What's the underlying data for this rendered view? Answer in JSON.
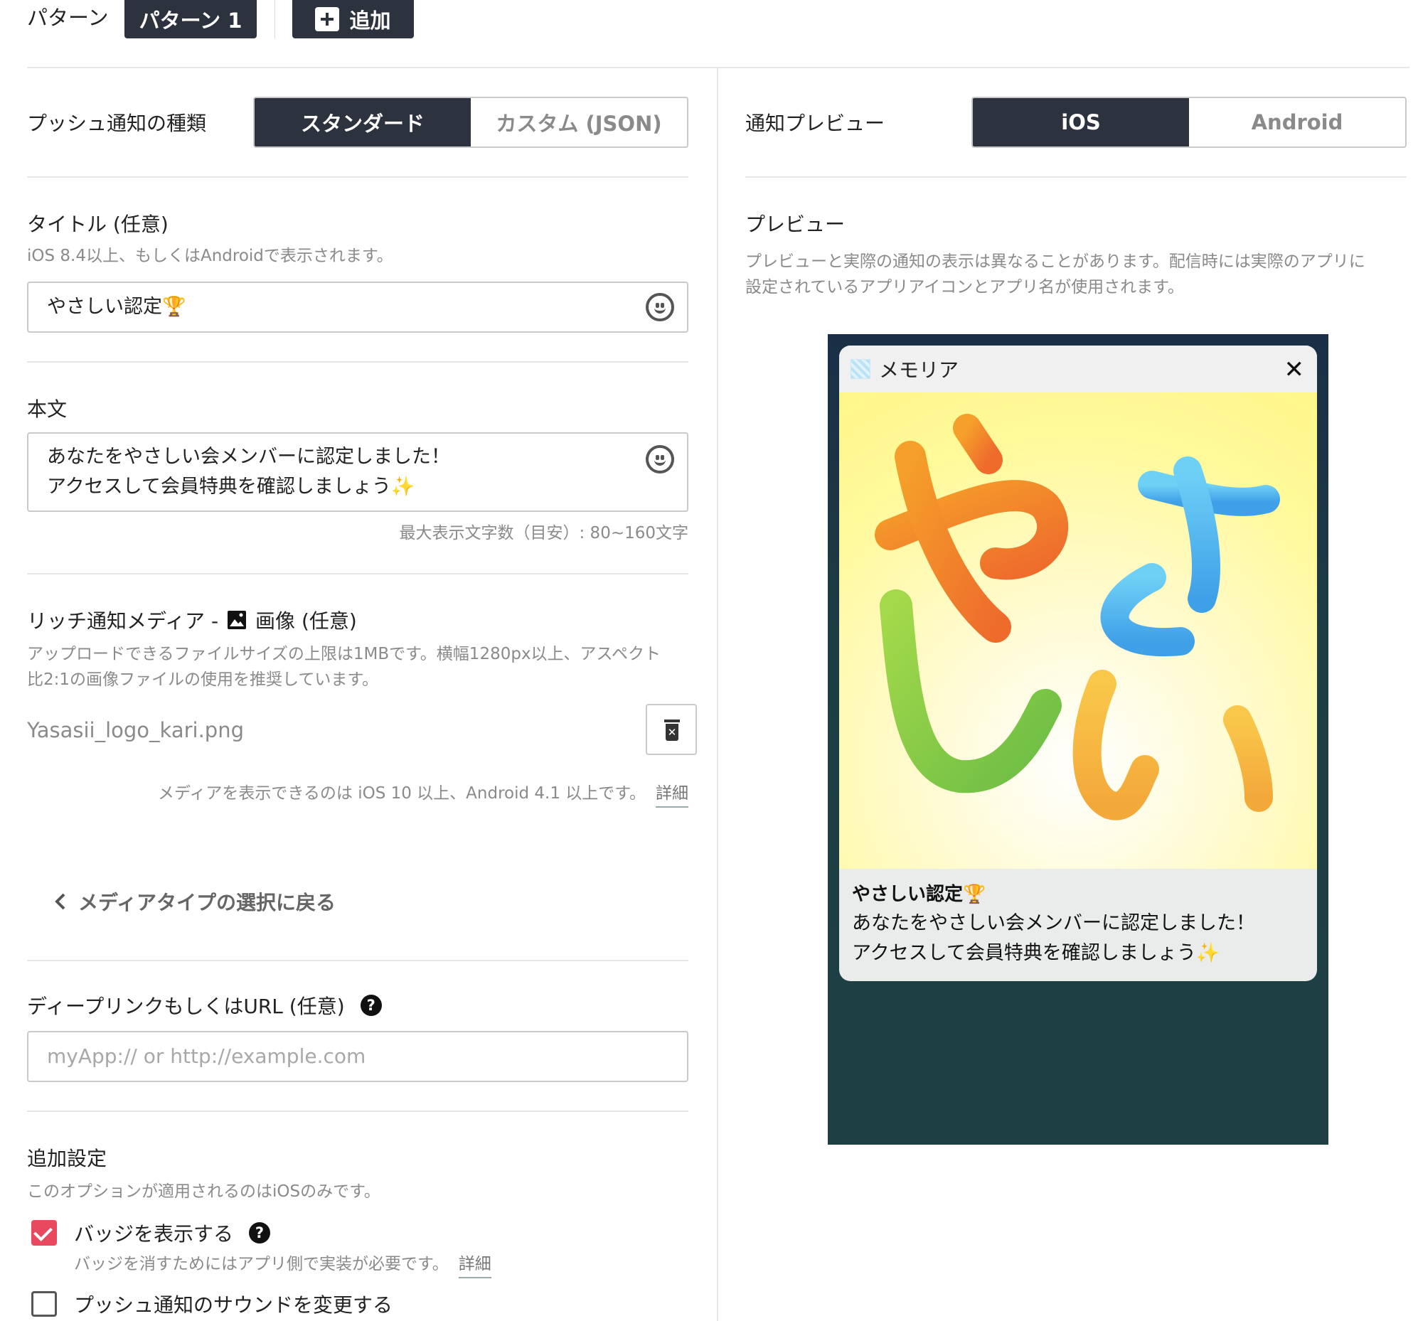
{
  "pattern": {
    "label": "パターン",
    "current": "パターン 1",
    "add_label": "追加"
  },
  "push_type": {
    "label": "プッシュ通知の種類",
    "options": [
      "スタンダード",
      "カスタム (JSON)"
    ],
    "selected": "スタンダード"
  },
  "title_field": {
    "label": "タイトル (任意)",
    "hint": "iOS 8.4以上、もしくはAndroidで表示されます。",
    "value": "やさしい認定🏆"
  },
  "body_field": {
    "label": "本文",
    "lines": [
      "あなたをやさしい会メンバーに認定しました！",
      "アクセスして会員特典を確認しましょう✨"
    ],
    "limit_hint": "最大表示文字数（目安）: 80~160文字"
  },
  "media": {
    "label_prefix": "リッチ通知メディア -",
    "label_suffix": "画像 (任意)",
    "hint_lines": [
      "アップロードできるファイルサイズの上限は1MBです。横幅1280px以上、アスペクト",
      "比2:1の画像ファイルの使用を推奨しています。"
    ],
    "filename": "Yasasii_logo_kari.png",
    "support_text": "メディアを表示できるのは iOS 10 以上、Android 4.1 以上です。",
    "detail_link": "詳細",
    "back_link": "メディアタイプの選択に戻る"
  },
  "deeplink": {
    "label": "ディープリンクもしくはURL (任意)",
    "placeholder": "myApp:// or http://example.com"
  },
  "extra": {
    "label": "追加設定",
    "hint": "このオプションが適用されるのはiOSのみです。",
    "badge_label": "バッジを表示する",
    "badge_checked": true,
    "badge_hint": "バッジを消すためにはアプリ側で実装が必要です。",
    "badge_detail": "詳細",
    "sound_label": "プッシュ通知のサウンドを変更する",
    "sound_checked": false
  },
  "preview": {
    "label": "通知プレビュー",
    "platforms": [
      "iOS",
      "Android"
    ],
    "selected": "iOS",
    "section_title": "プレビュー",
    "note_lines": [
      "プレビューと実際の通知の表示は異なることがあります。配信時には実際のアプリに",
      "設定されているアプリアイコンとアプリ名が使用されます。"
    ],
    "app_name": "メモリア",
    "close_glyph": "✕",
    "notif_title": "やさしい認定🏆",
    "notif_lines": [
      "あなたをやさしい会メンバーに認定しました！",
      "アクセスして会員特典を確認しましょう✨"
    ]
  },
  "colors": {
    "dark": "#2d323f",
    "accent_checkbox": "#e8495f",
    "border": "#c9c9c9",
    "hint": "#8a8a8a"
  },
  "icons": [
    "plus-icon",
    "smiley-icon",
    "image-icon",
    "trash-icon",
    "chevron-left-icon",
    "help-icon",
    "close-icon",
    "check-icon"
  ]
}
